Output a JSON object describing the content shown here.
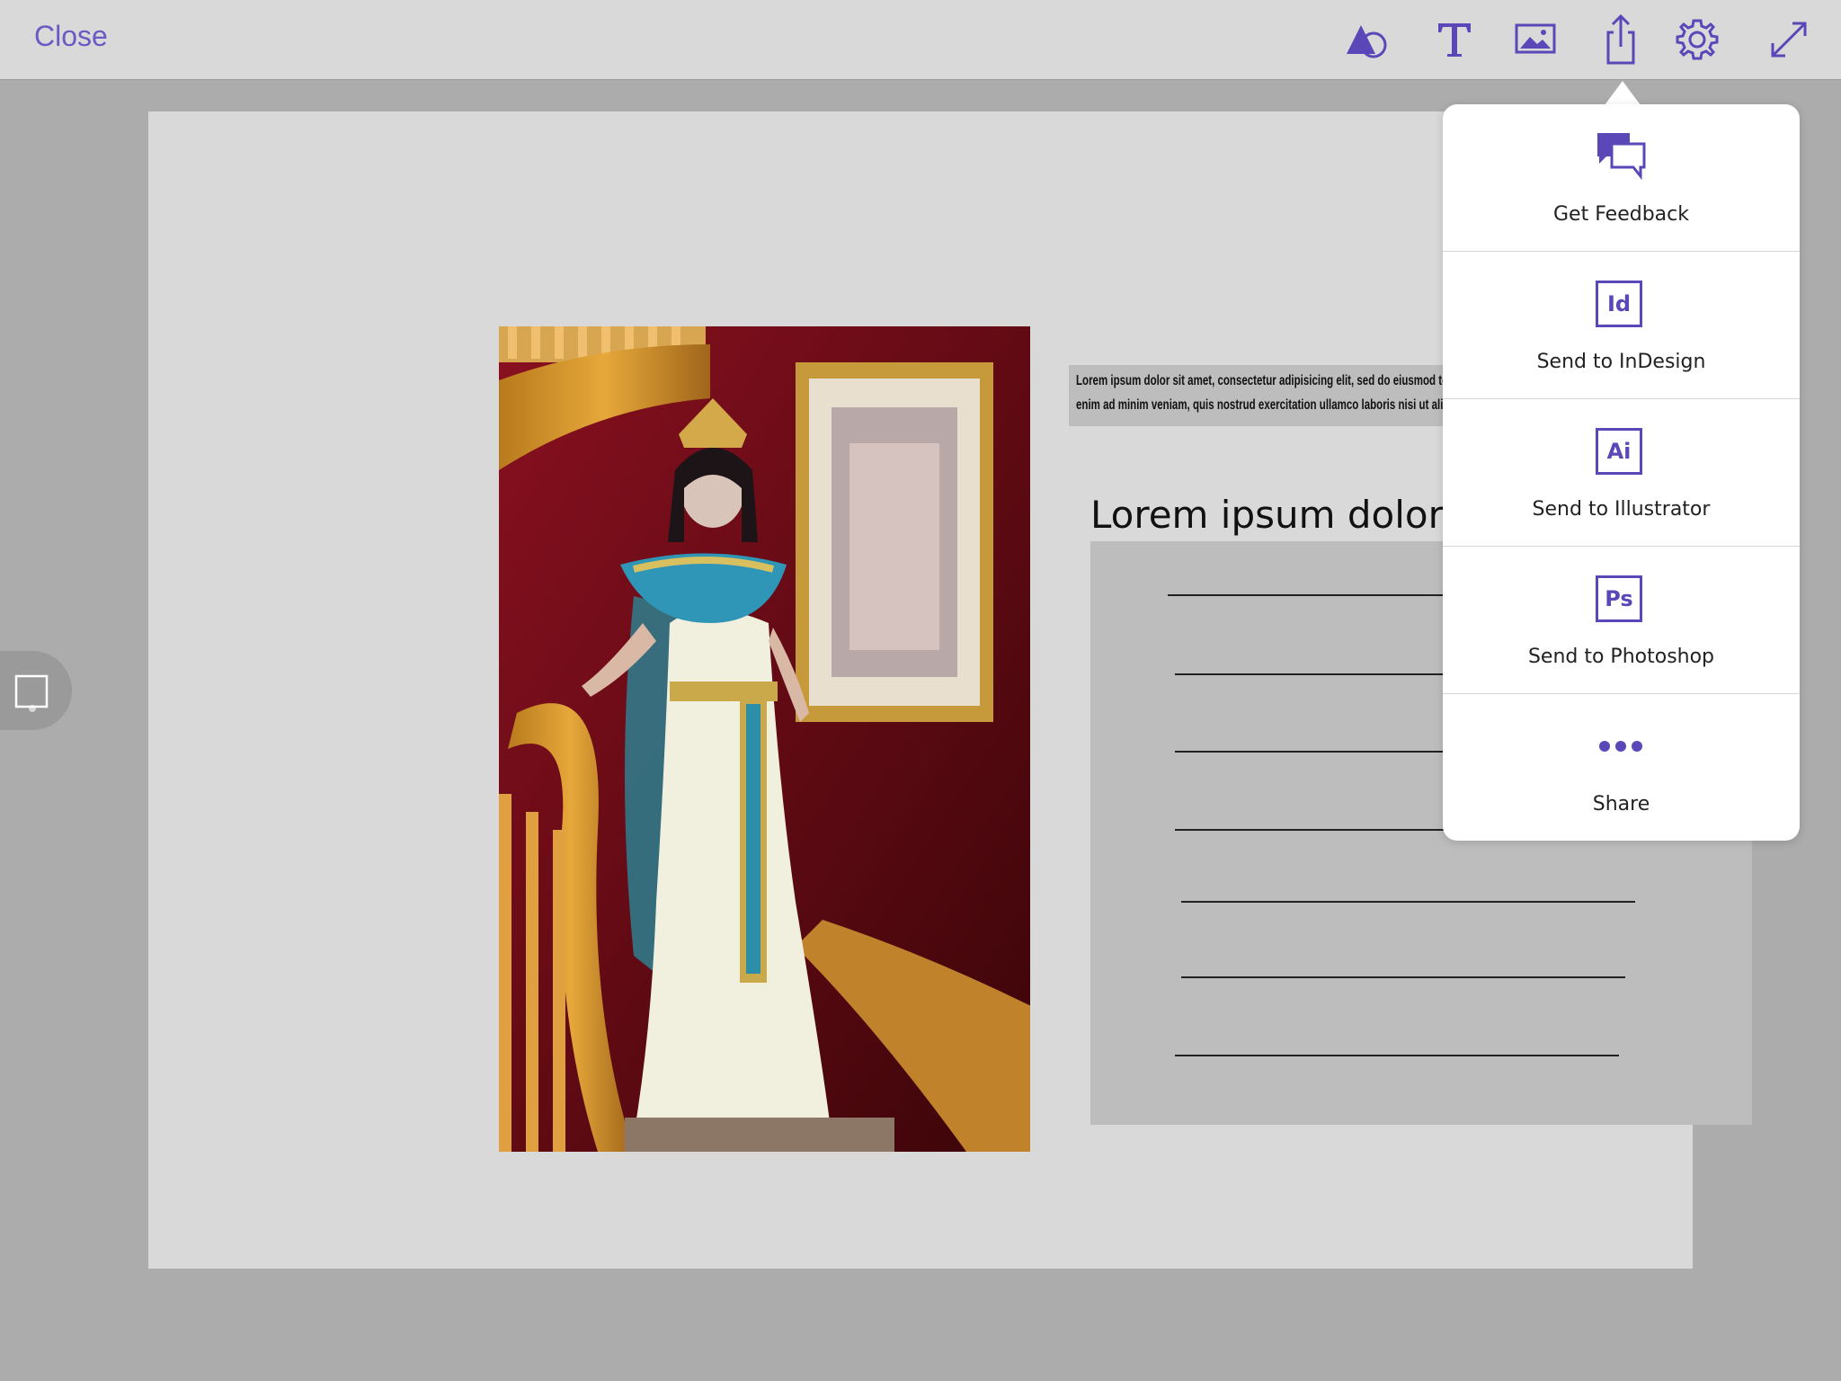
{
  "toolbar": {
    "close_label": "Close",
    "icons": [
      "shapes-icon",
      "text-tool-icon",
      "image-icon",
      "share-icon",
      "settings-icon",
      "fullscreen-icon"
    ]
  },
  "artboard": {
    "small_text": "Lorem ipsum dolor sit amet, consectetur adipisicing elit, sed do eiusmod tempor incididunt ut labore et dolore magna aliqua. Ut enim ad minim veniam, quis nostrud exercitation ullamco laboris nisi ut aliquip ex ea commodo consequat.",
    "heading": "Lorem ipsum dolor sit amet,"
  },
  "share_menu": {
    "items": [
      {
        "label": "Get Feedback",
        "icon": "feedback-icon"
      },
      {
        "label": "Send to InDesign",
        "icon": "indesign-icon",
        "badge": "Id"
      },
      {
        "label": "Send to Illustrator",
        "icon": "illustrator-icon",
        "badge": "Ai"
      },
      {
        "label": "Send to Photoshop",
        "icon": "photoshop-icon",
        "badge": "Ps"
      },
      {
        "label": "Share",
        "icon": "more-icon"
      }
    ]
  },
  "colors": {
    "accent": "#5b47b8",
    "toolbar_bg": "#d9d9d9",
    "workspace_bg": "#acacac",
    "artboard_bg": "#d9d9d9",
    "placeholder_bg": "#bdbdbd"
  }
}
